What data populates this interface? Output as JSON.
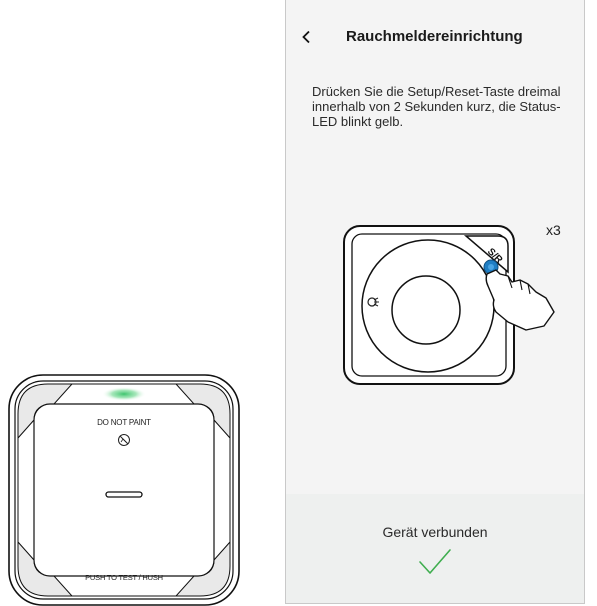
{
  "device": {
    "top_label": "DO NOT PAINT",
    "bottom_label": "PUSH TO TEST / HUSH",
    "icons": [
      "no-paint-icon",
      "status-led"
    ]
  },
  "screen": {
    "title": "Rauchmeldereinrichtung",
    "back_icon": "chevron-left-icon",
    "instruction": "Drücken Sie die Setup/Reset-Taste dreimal innerhalb von 2 Sekunden kurz, die Status-LED blinkt gelb.",
    "illustration": {
      "button_label": "S/R",
      "press_count": "x3"
    },
    "footer": {
      "status": "Gerät verbunden",
      "status_icon": "checkmark-icon"
    }
  },
  "colors": {
    "led_green": "#3ec46d",
    "button_blue": "#1f7ec4",
    "check_green": "#3fae4f"
  }
}
